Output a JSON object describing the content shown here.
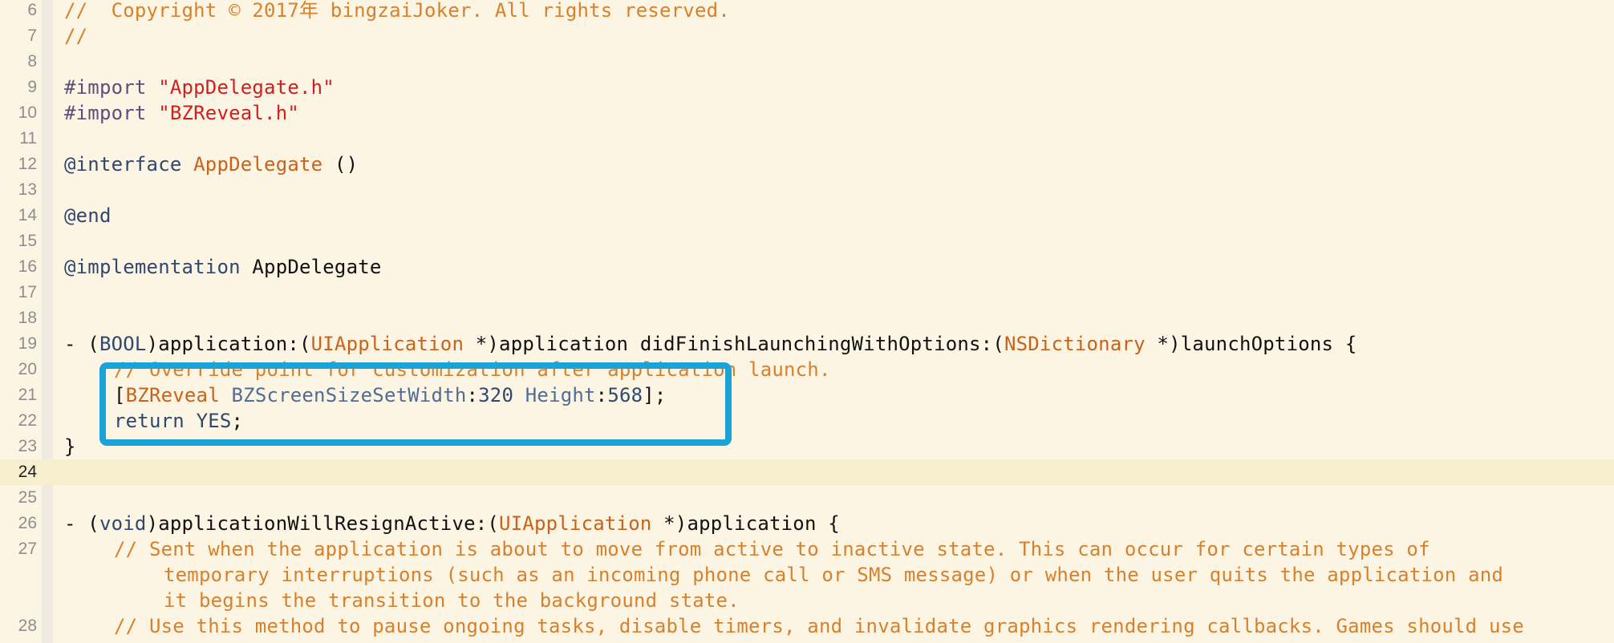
{
  "editor": {
    "lines": [
      {
        "no": "6",
        "tokens": [
          {
            "t": "//  Copyright © 2017年 bingzaiJoker. All rights reserved.",
            "c": "comment"
          }
        ]
      },
      {
        "no": "7",
        "tokens": [
          {
            "t": "//",
            "c": "comment"
          }
        ]
      },
      {
        "no": "8",
        "tokens": []
      },
      {
        "no": "9",
        "tokens": [
          {
            "t": "#import ",
            "c": "preproc"
          },
          {
            "t": "\"AppDelegate.h\"",
            "c": "string"
          }
        ]
      },
      {
        "no": "10",
        "tokens": [
          {
            "t": "#import ",
            "c": "preproc"
          },
          {
            "t": "\"BZReveal.h\"",
            "c": "string"
          }
        ]
      },
      {
        "no": "11",
        "tokens": []
      },
      {
        "no": "12",
        "tokens": [
          {
            "t": "@interface ",
            "c": "keyword"
          },
          {
            "t": "AppDelegate",
            "c": "type"
          },
          {
            "t": " ()",
            "c": "plain"
          }
        ]
      },
      {
        "no": "13",
        "tokens": []
      },
      {
        "no": "14",
        "tokens": [
          {
            "t": "@end",
            "c": "keyword"
          }
        ]
      },
      {
        "no": "15",
        "tokens": []
      },
      {
        "no": "16",
        "tokens": [
          {
            "t": "@implementation ",
            "c": "keyword"
          },
          {
            "t": "AppDelegate",
            "c": "plain"
          }
        ]
      },
      {
        "no": "17",
        "tokens": []
      },
      {
        "no": "18",
        "tokens": []
      },
      {
        "no": "19",
        "tokens": [
          {
            "t": "- (",
            "c": "plain"
          },
          {
            "t": "BOOL",
            "c": "keyword"
          },
          {
            "t": ")application:(",
            "c": "plain"
          },
          {
            "t": "UIApplication",
            "c": "type"
          },
          {
            "t": " *)application didFinishLaunchingWithOptions:(",
            "c": "plain"
          },
          {
            "t": "NSDictionary",
            "c": "type"
          },
          {
            "t": " *)launchOptions {",
            "c": "plain"
          }
        ]
      },
      {
        "no": "20",
        "indent": 1,
        "tokens": [
          {
            "t": "// Override point for customization after application launch.",
            "c": "comment"
          }
        ]
      },
      {
        "no": "21",
        "indent": 1,
        "tokens": [
          {
            "t": "[",
            "c": "plain"
          },
          {
            "t": "BZReveal",
            "c": "type"
          },
          {
            "t": " ",
            "c": "plain"
          },
          {
            "t": "BZScreenSizeSetWidth",
            "c": "method"
          },
          {
            "t": ":",
            "c": "plain"
          },
          {
            "t": "320",
            "c": "number"
          },
          {
            "t": " ",
            "c": "plain"
          },
          {
            "t": "Height",
            "c": "method"
          },
          {
            "t": ":",
            "c": "plain"
          },
          {
            "t": "568",
            "c": "number"
          },
          {
            "t": "];",
            "c": "plain"
          }
        ]
      },
      {
        "no": "22",
        "indent": 1,
        "tokens": [
          {
            "t": "return",
            "c": "keyword"
          },
          {
            "t": " ",
            "c": "plain"
          },
          {
            "t": "YES",
            "c": "keyword"
          },
          {
            "t": ";",
            "c": "plain"
          }
        ]
      },
      {
        "no": "23",
        "tokens": [
          {
            "t": "}",
            "c": "plain"
          }
        ]
      },
      {
        "no": "24",
        "current": true,
        "tokens": []
      },
      {
        "no": "25",
        "tokens": []
      },
      {
        "no": "26",
        "tokens": [
          {
            "t": "- (",
            "c": "plain"
          },
          {
            "t": "void",
            "c": "keyword"
          },
          {
            "t": ")applicationWillResignActive:(",
            "c": "plain"
          },
          {
            "t": "UIApplication",
            "c": "type"
          },
          {
            "t": " *)application {",
            "c": "plain"
          }
        ]
      },
      {
        "no": "27",
        "indent": 1,
        "tokens": [
          {
            "t": "// Sent when the application is about to move from active to inactive state. This can occur for certain types of",
            "c": "comment"
          }
        ]
      },
      {
        "no": "",
        "indent": 2,
        "tokens": [
          {
            "t": "temporary interruptions (such as an incoming phone call or SMS message) or when the user quits the application and",
            "c": "comment"
          }
        ]
      },
      {
        "no": "",
        "indent": 2,
        "tokens": [
          {
            "t": "it begins the transition to the background state.",
            "c": "comment"
          }
        ]
      },
      {
        "no": "28",
        "indent": 1,
        "tokens": [
          {
            "t": "// Use this method to pause ongoing tasks, disable timers, and invalidate graphics rendering callbacks. Games should use",
            "c": "comment"
          }
        ]
      }
    ]
  }
}
